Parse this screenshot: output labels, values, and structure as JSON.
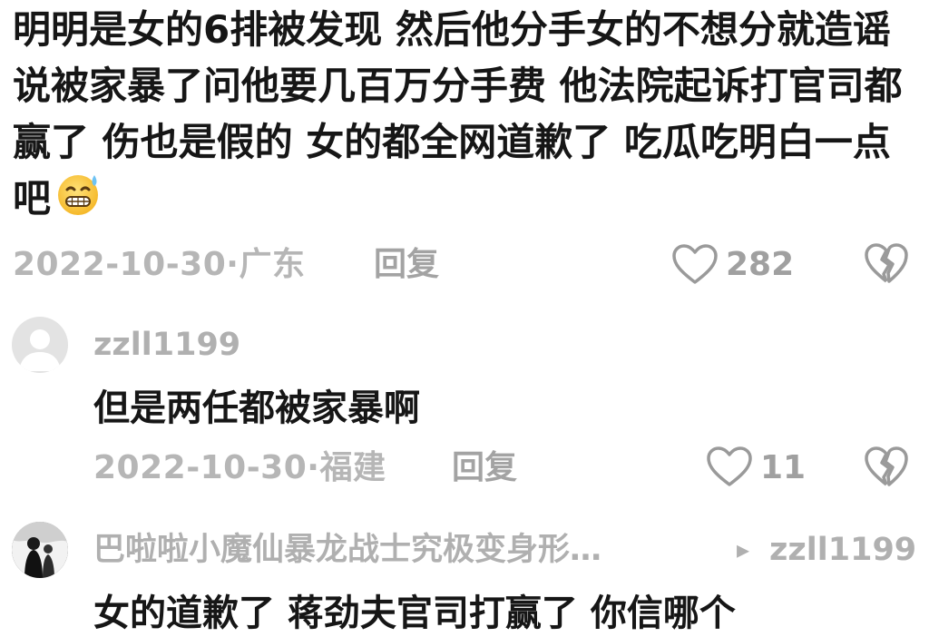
{
  "main_comment": {
    "text": "明明是女的6排被发现 然后他分手女的不想分就造谣说被家暴了问他要几百万分手费 他法院起诉打官司都赢了 伤也是假的 女的都全网道歉了 吃瓜吃明白一点吧",
    "emoji": "sweat-grin-emoji",
    "date_location": "2022-10-30·广东",
    "reply_label": "回复",
    "like_count": "282"
  },
  "replies": [
    {
      "username": "zzll1199",
      "avatar": "default-gray-avatar",
      "text": "但是两任都被家暴啊",
      "date_location": "2022-10-30·福建",
      "reply_label": "回复",
      "like_count": "11"
    },
    {
      "username": "巴啦啦小魔仙暴龙战士究极变身形…",
      "reply_arrow": "▸",
      "reply_to": "zzll1199",
      "avatar": "dark-photo-avatar",
      "text": "女的道歉了 蒋劲夫官司打赢了 你信哪个"
    }
  ],
  "colors": {
    "text": "#161616",
    "meta": "#b6b6b6",
    "icon": "#9a9a9a"
  }
}
